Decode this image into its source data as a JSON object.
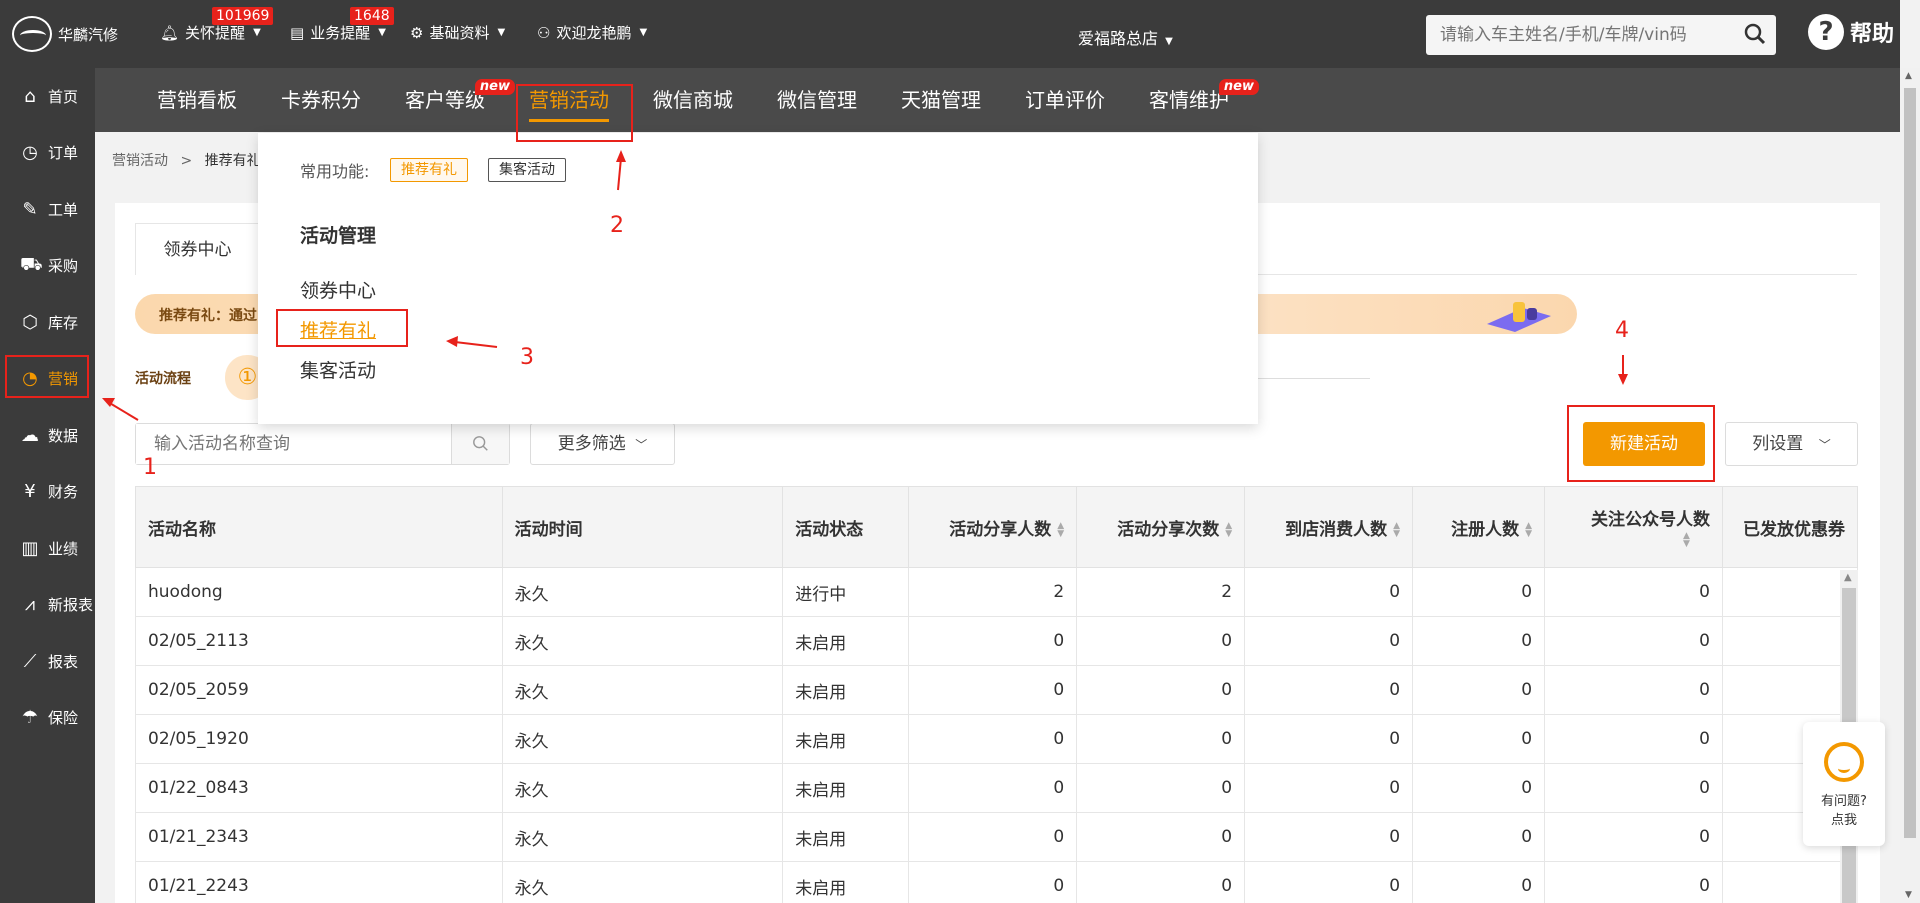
{
  "app": {
    "name": "华麟汽修"
  },
  "topnav": [
    {
      "label": "关怀提醒",
      "badge": "101969",
      "icon": "bell-icon"
    },
    {
      "label": "业务提醒",
      "badge": "1648",
      "icon": "document-icon"
    },
    {
      "label": "基础资料",
      "badge": "",
      "icon": "gear-icon"
    },
    {
      "label": "欢迎龙艳鹏",
      "badge": "",
      "icon": "user-icon"
    }
  ],
  "store": "爱福路总店",
  "search": {
    "placeholder": "请输入车主姓名/手机/车牌/vin码"
  },
  "help": {
    "label": "帮助"
  },
  "sidebar": [
    {
      "label": "首页",
      "icon": "home-icon"
    },
    {
      "label": "订单",
      "icon": "history-icon"
    },
    {
      "label": "工单",
      "icon": "wrench-icon"
    },
    {
      "label": "采购",
      "icon": "cart-icon"
    },
    {
      "label": "库存",
      "icon": "box-icon"
    },
    {
      "label": "营销",
      "icon": "pie-icon",
      "active": true
    },
    {
      "label": "数据",
      "icon": "cloud-icon"
    },
    {
      "label": "财务",
      "icon": "yen-icon"
    },
    {
      "label": "业绩",
      "icon": "bar-chart-icon"
    },
    {
      "label": "新报表",
      "icon": "line-chart-icon"
    },
    {
      "label": "报表",
      "icon": "trend-icon"
    },
    {
      "label": "保险",
      "icon": "umbrella-icon"
    }
  ],
  "subnav": [
    {
      "label": "营销看板"
    },
    {
      "label": "卡券积分"
    },
    {
      "label": "客户等级",
      "new": "new"
    },
    {
      "label": "营销活动",
      "active": true
    },
    {
      "label": "微信商城"
    },
    {
      "label": "微信管理"
    },
    {
      "label": "天猫管理"
    },
    {
      "label": "订单评价"
    },
    {
      "label": "客情维护",
      "new": "new"
    }
  ],
  "breadcrumb": {
    "parent": "营销活动",
    "sep": ">",
    "current": "推荐有礼"
  },
  "tabs": [
    {
      "label": "领券中心"
    }
  ],
  "banner": {
    "text": "推荐有礼：通过"
  },
  "flow": {
    "label": "活动流程",
    "step1": "①"
  },
  "list_search": {
    "placeholder": "输入活动名称查询"
  },
  "filter_button": "更多筛选",
  "new_button": "新建活动",
  "column_button": "列设置",
  "table": {
    "headers": [
      "活动名称",
      "活动时间",
      "活动状态",
      "活动分享人数",
      "活动分享次数",
      "到店消费人数",
      "注册人数",
      "关注公众号人数",
      "已发放优惠券"
    ],
    "rows": [
      [
        "huodong",
        "永久",
        "进行中",
        "2",
        "2",
        "0",
        "0",
        "0"
      ],
      [
        "02/05_2113",
        "永久",
        "未启用",
        "0",
        "0",
        "0",
        "0",
        "0"
      ],
      [
        "02/05_2059",
        "永久",
        "未启用",
        "0",
        "0",
        "0",
        "0",
        "0"
      ],
      [
        "02/05_1920",
        "永久",
        "未启用",
        "0",
        "0",
        "0",
        "0",
        "0"
      ],
      [
        "01/22_0843",
        "永久",
        "未启用",
        "0",
        "0",
        "0",
        "0",
        "0"
      ],
      [
        "01/21_2343",
        "永久",
        "未启用",
        "0",
        "0",
        "0",
        "0",
        "0"
      ],
      [
        "01/21_2243",
        "永久",
        "未启用",
        "0",
        "0",
        "0",
        "0",
        "0"
      ]
    ]
  },
  "dropdown": {
    "common_label": "常用功能:",
    "chips": [
      "推荐有礼",
      "集客活动"
    ],
    "section_title": "活动管理",
    "items": [
      {
        "label": "领券中心"
      },
      {
        "label": "推荐有礼",
        "active": true
      },
      {
        "label": "集客活动"
      }
    ]
  },
  "annotations": [
    "1",
    "2",
    "3",
    "4"
  ],
  "service": {
    "line1": "有问题?",
    "line2": "点我"
  },
  "colors": {
    "accent": "#f39800",
    "dark": "#3b3b3b",
    "red": "#e7221b"
  }
}
